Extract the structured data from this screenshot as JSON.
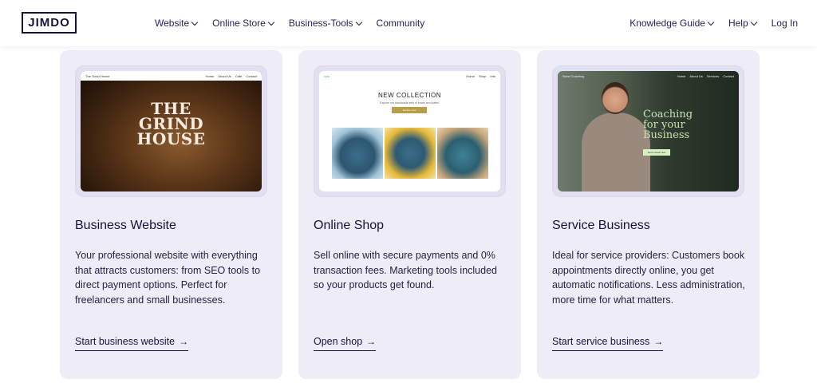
{
  "header": {
    "logo": "JIMDO",
    "nav_left": [
      {
        "label": "Website",
        "dropdown": true
      },
      {
        "label": "Online Store",
        "dropdown": true
      },
      {
        "label": "Business-Tools",
        "dropdown": true
      },
      {
        "label": "Community",
        "dropdown": false
      }
    ],
    "nav_right": [
      {
        "label": "Knowledge Guide",
        "dropdown": true
      },
      {
        "label": "Help",
        "dropdown": true
      },
      {
        "label": "Log In",
        "dropdown": false
      }
    ]
  },
  "cards": [
    {
      "title": "Business Website",
      "description": "Your professional website with everything that attracts customers: from SEO tools to direct payment options. Perfect for freelancers and small businesses.",
      "link": "Start business website",
      "preview": {
        "site_name": "The Grind House",
        "nav": [
          "Home",
          "About Us",
          "Café",
          "Contact"
        ],
        "headline": [
          "THE",
          "GRIND",
          "HOUSE"
        ]
      }
    },
    {
      "title": "Online Shop",
      "description": "Sell online with secure payments and 0% transaction fees. Marketing tools included so your products get found.",
      "link": "Open shop",
      "preview": {
        "site_name": "cylo",
        "nav": [
          "Home",
          "Shop",
          "Info"
        ],
        "headline": "NEW COLLECTION",
        "subline": "Explore our handmade sets of bowls and plates.",
        "button": "Explore now"
      }
    },
    {
      "title": "Service Business",
      "description": "Ideal for service providers: Customers book appointments directly online, you get automatic notifications. Less administration, more time for what matters.",
      "link": "Start service business",
      "preview": {
        "site_name": "Nova Coaching",
        "nav": [
          "Home",
          "About Us",
          "Services",
          "Contact"
        ],
        "headline": [
          "Coaching",
          "for your",
          "Business"
        ],
        "button": "Get in touch now"
      }
    }
  ],
  "icons": {
    "dropdown": "chevron-down-icon",
    "link_arrow": "arrow-right-icon"
  },
  "colors": {
    "brand_navy": "#14143a",
    "card_bg": "#eeecf6",
    "shop_button": "#b99d4b",
    "coach_accent": "#c9e3b2"
  }
}
